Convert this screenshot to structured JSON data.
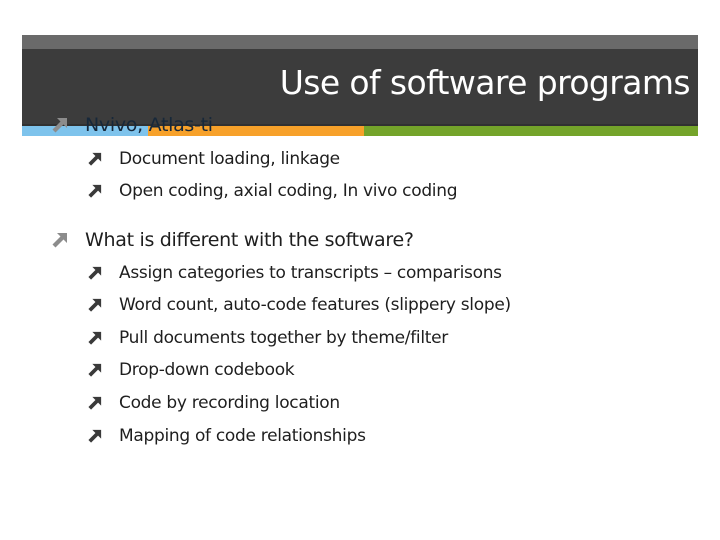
{
  "slide": {
    "title": "Use of software programs",
    "colors": {
      "header_top_strip": "#6a6a6a",
      "header_band": "#3c3c3c",
      "accent_blue": "#7ec3ec",
      "accent_orange": "#f7a12a",
      "accent_green": "#74a42a",
      "title_text": "#ffffff",
      "body_text": "#1e1e1e",
      "bullet_level1": "#8c8c8c",
      "bullet_level2": "#3a3a3a"
    },
    "bullet_icon": "arrow-up-right-icon",
    "bullets": [
      {
        "text": "Nvivo, Atlas-ti",
        "level": 1,
        "children": [
          {
            "text": "Document loading, linkage",
            "level": 2
          },
          {
            "text": "Open coding, axial coding, In vivo coding",
            "level": 2
          }
        ]
      },
      {
        "text": "What is different with the software?",
        "level": 1,
        "children": [
          {
            "text": "Assign categories to transcripts – comparisons",
            "level": 2
          },
          {
            "text": "Word count, auto-code features (slippery slope)",
            "level": 2
          },
          {
            "text": "Pull documents together by theme/filter",
            "level": 2
          },
          {
            "text": "Drop-down codebook",
            "level": 2
          },
          {
            "text": "Code by recording location",
            "level": 2
          },
          {
            "text": "Mapping of code relationships",
            "level": 2
          }
        ]
      }
    ]
  }
}
